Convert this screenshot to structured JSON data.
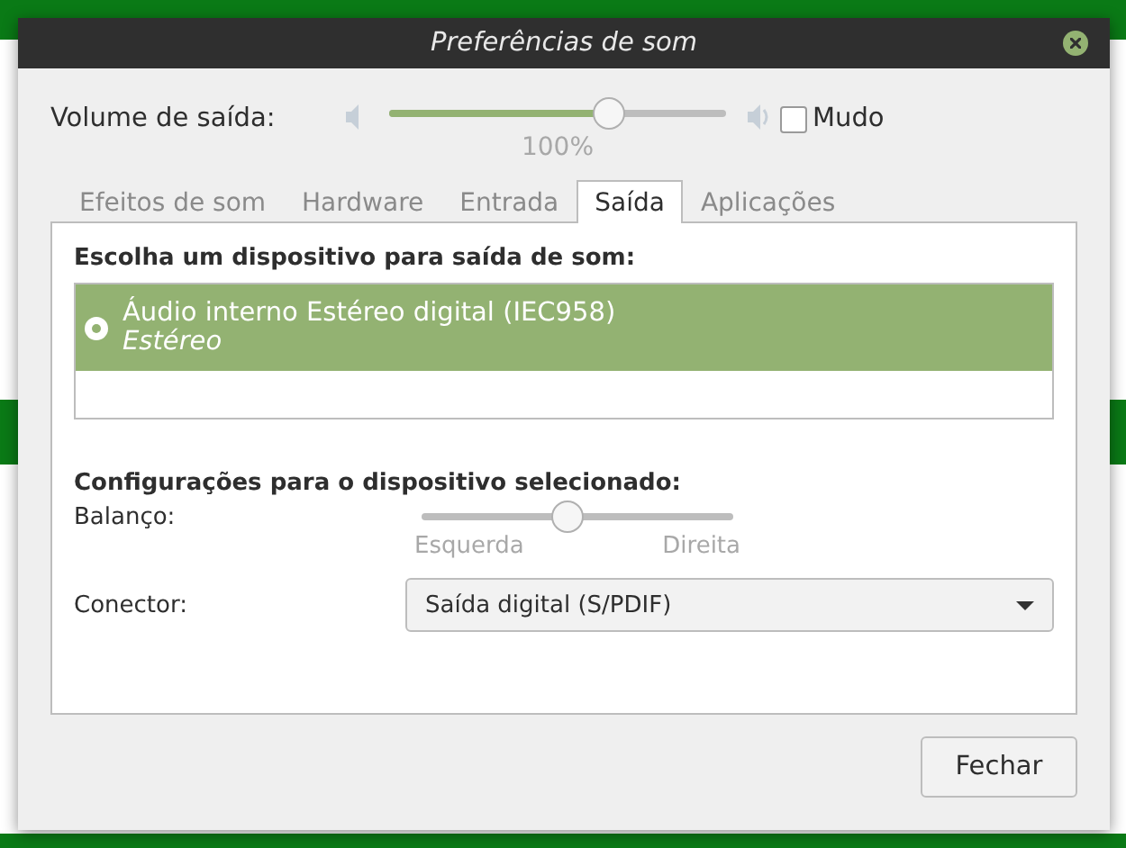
{
  "window": {
    "title": "Preferências de som"
  },
  "volume": {
    "label": "Volume de saída:",
    "level": 0.65,
    "reading": "100%",
    "mute": {
      "label": "Mudo",
      "checked": false
    }
  },
  "tabs": [
    {
      "label": "Efeitos de som",
      "selected": false
    },
    {
      "label": "Hardware",
      "selected": false
    },
    {
      "label": "Entrada",
      "selected": false
    },
    {
      "label": "Saída",
      "selected": true
    },
    {
      "label": "Aplicações",
      "selected": false
    }
  ],
  "device_heading": "Escolha um dispositivo para saída de som:",
  "devices": [
    {
      "name": "Áudio interno Estéreo digital (IEC958)",
      "profile": "Estéreo",
      "selected": true
    }
  ],
  "settings_heading": "Configurações para o dispositivo selecionado:",
  "balance": {
    "label": "Balanço:",
    "level": 0.47,
    "left_label": "Esquerda",
    "right_label": "Direita"
  },
  "connector": {
    "label": "Conector:",
    "value": "Saída digital (S/PDIF)"
  },
  "buttons": [
    "Fechar"
  ]
}
